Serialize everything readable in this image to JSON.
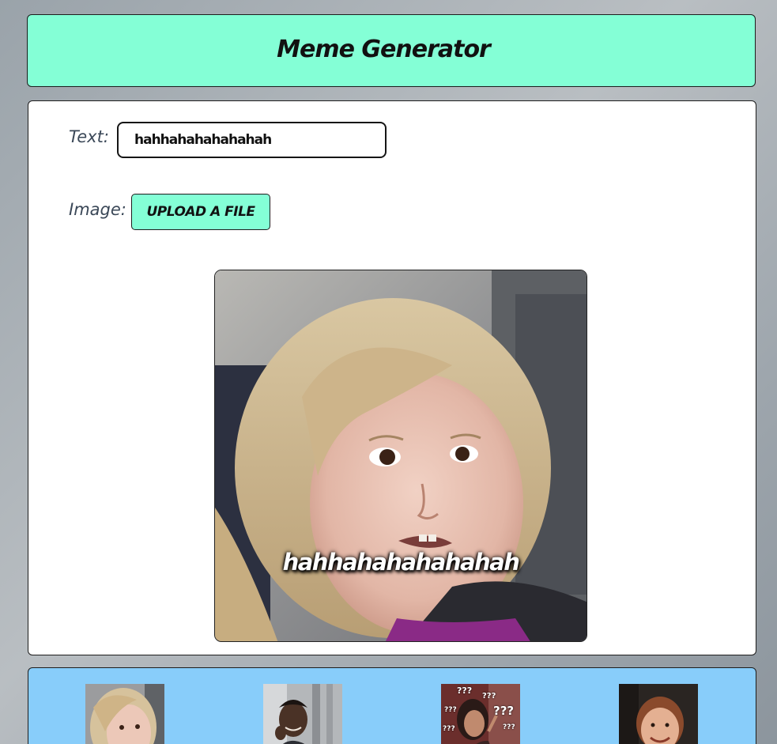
{
  "header": {
    "title": "Meme Generator"
  },
  "form": {
    "text_label": "Text:",
    "text_value": "hahhahahahahahah",
    "image_label": "Image:",
    "upload_label": "UPLOAD A FILE"
  },
  "meme": {
    "caption": "hahhahahahahahah"
  },
  "gallery": {
    "thumbnails": [
      {
        "name": "side-eye-girl"
      },
      {
        "name": "thinking-man"
      },
      {
        "name": "confused-woman",
        "overlay_text": [
          "???",
          "???",
          "???",
          "???",
          "???",
          "???"
        ]
      },
      {
        "name": "smiling-boy"
      }
    ]
  },
  "colors": {
    "accent": "#84ffd6",
    "gallery_bg": "#88cdfa",
    "label": "#3b4858"
  }
}
